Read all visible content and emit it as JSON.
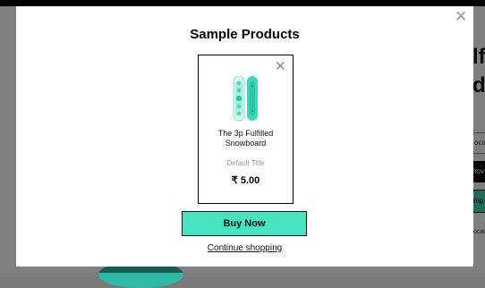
{
  "background": {
    "heading": "lf\nd",
    "field_text": "oca",
    "black_button_text": "hov",
    "teal_button_text": "mp",
    "small_text": "ocal"
  },
  "modal": {
    "title": "Sample Products",
    "close_icon": "close-icon",
    "product": {
      "close_icon": "close-icon",
      "image_icon": "snowboard-image",
      "name": "The 3p Fulfilled Snowboard",
      "variant": "Default Title",
      "price": "₹ 5.00"
    },
    "buy_label": "Buy Now",
    "continue_label": "Continue shopping"
  },
  "colors": {
    "accent": "#48e3bf",
    "overlay": "rgba(0,0,0,0.5)",
    "snowboard": "#40d6b8"
  }
}
